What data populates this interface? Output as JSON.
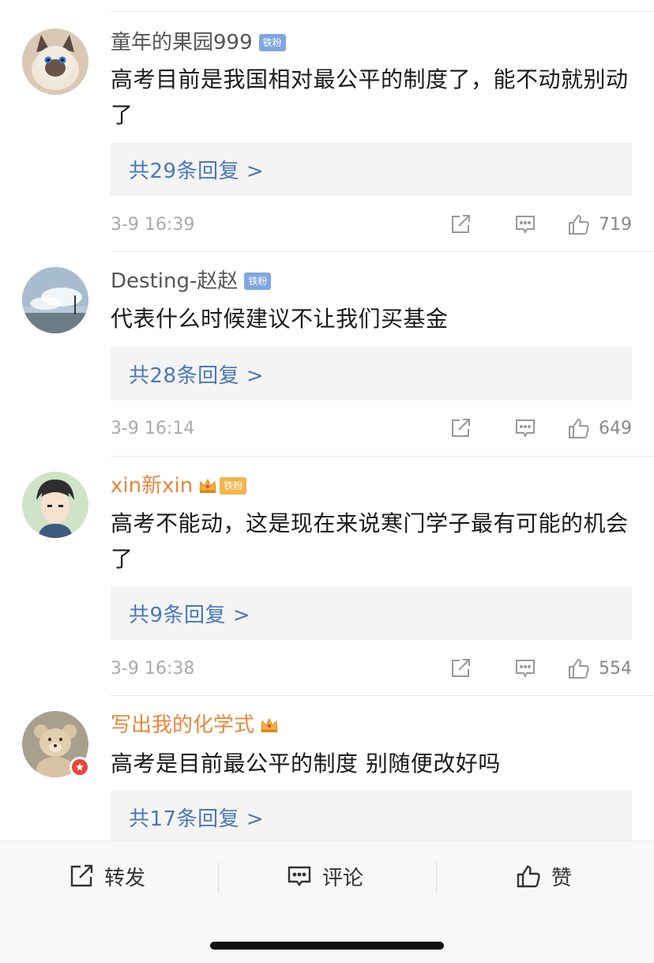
{
  "comments": [
    {
      "username": "童年的果园999",
      "badge": "铁粉",
      "text": "高考目前是我国相对最公平的制度了，能不动就别动了",
      "replies": "共29条回复 >",
      "time": "3-9 16:39",
      "likes": "719"
    },
    {
      "username": "Desting-赵赵",
      "badge": "铁粉",
      "text": "代表什么时候建议不让我们买基金",
      "replies": "共28条回复 >",
      "time": "3-9 16:14",
      "likes": "649"
    },
    {
      "username": "xin新xin",
      "badge": "铁粉",
      "text": "高考不能动，这是现在来说寒门学子最有可能的机会了",
      "replies": "共9条回复 >",
      "time": "3-9 16:38",
      "likes": "554"
    },
    {
      "username": "写出我的化学式",
      "text": "高考是目前最公平的制度 别随便改好吗",
      "replies": "共17条回复 >"
    }
  ],
  "bottom_bar": {
    "repost": "转发",
    "comment": "评论",
    "like": "赞"
  },
  "colors": {
    "link": "#4a78b8",
    "gold_name": "#e8873a",
    "fan_badge": "#7fa7e0",
    "vip_red": "#e8463c"
  },
  "icons": [
    "share-icon",
    "comment-icon",
    "thumbs-up-icon",
    "crown-icon",
    "vip-icon"
  ]
}
